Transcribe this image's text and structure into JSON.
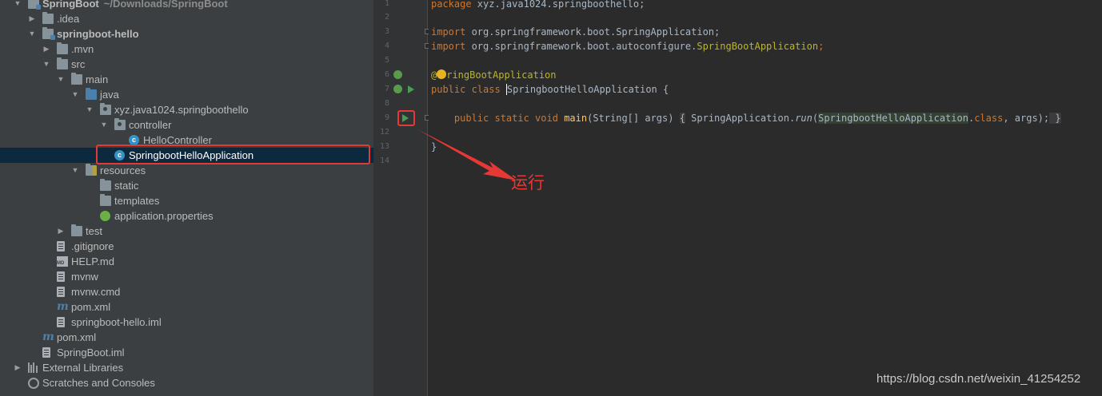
{
  "tree": {
    "items": [
      {
        "name": "tree-root",
        "label": "SpringBoot",
        "path": "~/Downloads/SpringBoot",
        "icon": "folder-module-icon",
        "bold": true,
        "arrow": "▼"
      },
      {
        "name": "tree-idea",
        "label": ".idea",
        "icon": "folder-icon",
        "arrow": "▶"
      },
      {
        "name": "tree-springboot-hello",
        "label": "springboot-hello",
        "icon": "folder-module-icon",
        "bold": true,
        "arrow": "▼"
      },
      {
        "name": "tree-mvn",
        "label": ".mvn",
        "icon": "folder-icon",
        "arrow": "▶"
      },
      {
        "name": "tree-src",
        "label": "src",
        "icon": "folder-icon",
        "arrow": "▼"
      },
      {
        "name": "tree-main",
        "label": "main",
        "icon": "folder-icon",
        "arrow": "▼"
      },
      {
        "name": "tree-java",
        "label": "java",
        "icon": "source-folder-icon",
        "arrow": "▼"
      },
      {
        "name": "tree-package",
        "label": "xyz.java1024.springboothello",
        "icon": "package-icon",
        "arrow": "▼"
      },
      {
        "name": "tree-controller",
        "label": "controller",
        "icon": "package-icon",
        "arrow": "▼"
      },
      {
        "name": "tree-hellocontroller",
        "label": "HelloController",
        "icon": "class-icon",
        "arrow": ""
      },
      {
        "name": "tree-springboothelloapplication",
        "label": "SpringbootHelloApplication",
        "icon": "spring-boot-class-icon",
        "arrow": "",
        "selected": true
      },
      {
        "name": "tree-resources",
        "label": "resources",
        "icon": "resources-folder-icon",
        "arrow": "▼"
      },
      {
        "name": "tree-static",
        "label": "static",
        "icon": "folder-icon",
        "arrow": ""
      },
      {
        "name": "tree-templates",
        "label": "templates",
        "icon": "folder-icon",
        "arrow": ""
      },
      {
        "name": "tree-application-properties",
        "label": "application.properties",
        "icon": "spring-properties-icon",
        "arrow": ""
      },
      {
        "name": "tree-test",
        "label": "test",
        "icon": "folder-icon",
        "arrow": "▶"
      },
      {
        "name": "tree-gitignore",
        "label": ".gitignore",
        "icon": "file-icon",
        "arrow": ""
      },
      {
        "name": "tree-help-md",
        "label": "HELP.md",
        "icon": "markdown-icon",
        "arrow": ""
      },
      {
        "name": "tree-mvnw",
        "label": "mvnw",
        "icon": "file-icon",
        "arrow": ""
      },
      {
        "name": "tree-mvnw-cmd",
        "label": "mvnw.cmd",
        "icon": "file-icon",
        "arrow": ""
      },
      {
        "name": "tree-pom-xml",
        "label": "pom.xml",
        "icon": "maven-icon",
        "arrow": ""
      },
      {
        "name": "tree-springboot-hello-iml",
        "label": "springboot-hello.iml",
        "icon": "file-icon",
        "arrow": ""
      },
      {
        "name": "tree-root-pom-xml",
        "label": "pom.xml",
        "icon": "maven-icon",
        "arrow": ""
      },
      {
        "name": "tree-springboot-iml",
        "label": "SpringBoot.iml",
        "icon": "file-icon",
        "arrow": ""
      },
      {
        "name": "tree-external-libraries",
        "label": "External Libraries",
        "icon": "library-icon",
        "arrow": "▶"
      },
      {
        "name": "tree-scratches",
        "label": "Scratches and Consoles",
        "icon": "scratches-icon",
        "arrow": ""
      }
    ]
  },
  "gutter": {
    "line_numbers": [
      "1",
      "2",
      "3",
      "4",
      "5",
      "6",
      "7",
      "8",
      "9",
      "12",
      "13",
      "14"
    ]
  },
  "editor": {
    "l1_kw": "package",
    "l1_rest": " xyz.java1024.springboothello;",
    "l3_kw": "import",
    "l3_rest": " org.springframework.boot.SpringApplication;",
    "l4_kw": "import",
    "l4_rest": " org.springframework.boot.autoconfigure.",
    "l4_cls": "SpringBootApplication",
    "l4_end": ";",
    "l6_at": "@",
    "l6_ann": "ringBootApplication",
    "l7_kw": "public class ",
    "l7_cls": "SpringbootHelloApplication",
    "l7_end": " {",
    "l9_indent": "    ",
    "l9_kw": "public static void ",
    "l9_fn": "main",
    "l9_args": "(String[] args) ",
    "l9_open": "{",
    "l9_call": " SpringApplication.",
    "l9_run": "run",
    "l9_paren": "(",
    "l9_cls": "SpringbootHelloApplication",
    "l9_dot": ".",
    "l9_classkw": "class",
    "l9_tail": ", args);",
    "l9_close": " }",
    "l13": "}"
  },
  "annotation": {
    "label": "运行",
    "color": "#e53935"
  },
  "watermark": "https://blog.csdn.net/weixin_41254252"
}
